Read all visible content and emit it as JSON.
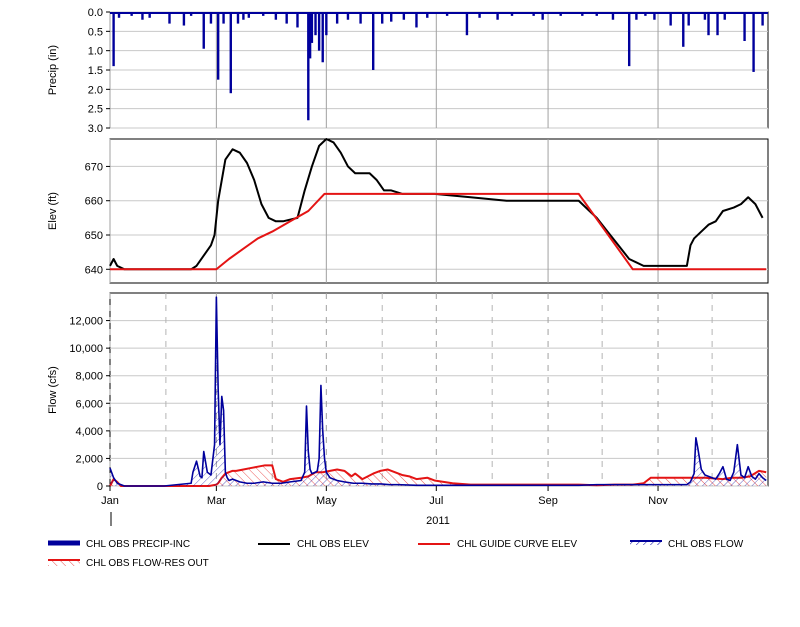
{
  "chart_data": [
    {
      "type": "bar",
      "ylabel": "Precip (in)",
      "ylim": [
        0,
        3.0
      ],
      "y_inverted": true,
      "yticks": [
        "0.0",
        "0.5",
        "1.0",
        "1.5",
        "2.0",
        "2.5",
        "3.0"
      ],
      "grid": true,
      "color": "#00009c",
      "series": [
        {
          "name": "CHL OBS PRECIP-INC",
          "days": [
            2,
            5,
            12,
            18,
            22,
            33,
            41,
            45,
            52,
            56,
            60,
            63,
            67,
            71,
            74,
            77,
            85,
            92,
            98,
            104,
            110,
            111,
            112,
            114,
            116,
            118,
            120,
            126,
            132,
            139,
            146,
            151,
            156,
            163,
            170,
            176,
            187,
            198,
            205,
            215,
            223,
            235,
            240,
            250,
            262,
            270,
            279,
            288,
            292,
            297,
            302,
            311,
            318,
            321,
            330,
            332,
            337,
            341,
            352,
            357,
            362
          ],
          "values": [
            1.4,
            0.15,
            0.1,
            0.2,
            0.15,
            0.3,
            0.35,
            0.1,
            0.95,
            0.3,
            1.75,
            0.3,
            2.1,
            0.3,
            0.2,
            0.15,
            0.1,
            0.2,
            0.3,
            0.4,
            2.8,
            1.2,
            0.8,
            0.6,
            1.0,
            1.3,
            0.6,
            0.3,
            0.2,
            0.3,
            1.5,
            0.3,
            0.25,
            0.2,
            0.4,
            0.15,
            0.1,
            0.6,
            0.15,
            0.2,
            0.1,
            0.1,
            0.2,
            0.1,
            0.1,
            0.1,
            0.2,
            1.4,
            0.2,
            0.1,
            0.2,
            0.35,
            0.9,
            0.35,
            0.2,
            0.6,
            0.6,
            0.2,
            0.75,
            1.55,
            0.35
          ]
        }
      ]
    },
    {
      "type": "line",
      "ylabel": "Elev (ft)",
      "ylim": [
        636,
        678
      ],
      "yticks": [
        "640",
        "650",
        "660",
        "670"
      ],
      "grid": true,
      "series": [
        {
          "name": "CHL OBS ELEV",
          "color": "#000000",
          "days": [
            0,
            2,
            4,
            8,
            20,
            30,
            45,
            48,
            52,
            56,
            58,
            60,
            64,
            68,
            72,
            76,
            80,
            84,
            88,
            92,
            96,
            104,
            108,
            112,
            116,
            120,
            124,
            128,
            132,
            136,
            140,
            144,
            148,
            152,
            156,
            162,
            170,
            180,
            200,
            220,
            240,
            260,
            270,
            276,
            282,
            288,
            296,
            306,
            314,
            320,
            322,
            324,
            328,
            332,
            336,
            340,
            346,
            350,
            354,
            358,
            362
          ],
          "values": [
            641,
            643,
            641,
            640,
            640,
            640,
            640,
            641,
            644,
            647,
            650,
            660,
            672,
            675,
            674,
            671,
            666,
            659,
            655,
            654,
            654,
            655,
            663,
            670,
            676,
            678,
            677,
            674,
            670,
            668,
            668,
            668,
            666,
            663,
            663,
            662,
            662,
            662,
            661,
            660,
            660,
            660,
            655,
            651,
            647,
            643,
            641,
            641,
            641,
            641,
            647,
            649,
            651,
            653,
            654,
            657,
            658,
            659,
            661,
            659,
            655
          ]
        },
        {
          "name": "CHL GUIDE CURVE ELEV",
          "color": "#e41414",
          "days": [
            0,
            59,
            66,
            74,
            82,
            90,
            100,
            110,
            119,
            130,
            150,
            200,
            250,
            260,
            290,
            296,
            364
          ],
          "values": [
            640,
            640,
            643,
            646,
            649,
            651,
            654,
            657,
            662,
            662,
            662,
            662,
            662,
            662,
            640,
            640,
            640
          ]
        }
      ]
    },
    {
      "type": "line",
      "ylabel": "Flow (cfs)",
      "ylim": [
        0,
        14000
      ],
      "yticks": [
        "0",
        "2,000",
        "4,000",
        "6,000",
        "8,000",
        "10,000",
        "12,000"
      ],
      "grid": true,
      "x_ticks": [
        "Jan",
        "Mar",
        "May",
        "Jul",
        "Sep",
        "Nov"
      ],
      "x_tick_days": [
        0,
        59,
        120,
        181,
        243,
        304
      ],
      "xlabel": "2011",
      "series": [
        {
          "name": "CHL OBS FLOW",
          "color": "#00009c",
          "days": [
            0,
            2,
            4,
            6,
            8,
            15,
            30,
            45,
            46,
            48,
            50,
            51,
            52,
            54,
            56,
            58,
            59,
            60,
            61,
            62,
            63,
            64,
            65,
            66,
            68,
            70,
            72,
            76,
            80,
            85,
            90,
            95,
            100,
            106,
            108,
            109,
            110,
            111,
            112,
            114,
            115,
            116,
            117,
            118,
            119,
            120,
            122,
            124,
            126,
            130,
            135,
            140,
            145,
            150,
            155,
            160,
            170,
            180,
            200,
            220,
            240,
            250,
            260,
            270,
            280,
            290,
            300,
            310,
            320,
            322,
            324,
            325,
            326,
            328,
            330,
            332,
            334,
            336,
            338,
            340,
            342,
            344,
            346,
            348,
            350,
            352,
            354,
            356,
            358,
            360,
            362,
            364
          ],
          "values": [
            1300,
            600,
            200,
            100,
            0,
            0,
            0,
            200,
            1000,
            1800,
            700,
            600,
            2500,
            1000,
            800,
            3000,
            13700,
            7000,
            3000,
            6500,
            5500,
            1000,
            600,
            400,
            500,
            400,
            300,
            200,
            200,
            300,
            200,
            200,
            300,
            400,
            1000,
            5800,
            2500,
            1200,
            900,
            1000,
            1100,
            2000,
            7300,
            4000,
            2000,
            1000,
            600,
            500,
            400,
            300,
            200,
            200,
            150,
            150,
            100,
            100,
            50,
            50,
            50,
            50,
            50,
            50,
            50,
            100,
            100,
            100,
            100,
            100,
            100,
            300,
            900,
            3500,
            2800,
            1200,
            800,
            700,
            600,
            500,
            900,
            1400,
            500,
            400,
            1000,
            3000,
            800,
            600,
            1400,
            700,
            500,
            900,
            600,
            400
          ]
        },
        {
          "name": "CHL OBS FLOW-RES OUT",
          "color": "#e41414",
          "days": [
            0,
            2,
            4,
            6,
            10,
            20,
            40,
            55,
            59,
            60,
            62,
            64,
            66,
            68,
            70,
            74,
            78,
            82,
            86,
            90,
            92,
            96,
            100,
            106,
            110,
            114,
            118,
            122,
            126,
            130,
            134,
            136,
            140,
            146,
            150,
            154,
            158,
            162,
            166,
            170,
            176,
            180,
            190,
            200,
            220,
            240,
            260,
            270,
            280,
            285,
            290,
            296,
            300,
            310,
            320,
            330,
            340,
            345,
            350,
            355,
            360,
            364
          ],
          "values": [
            0,
            500,
            300,
            0,
            0,
            0,
            0,
            0,
            100,
            200,
            600,
            900,
            1000,
            1100,
            1100,
            1200,
            1300,
            1400,
            1500,
            1500,
            500,
            300,
            500,
            600,
            700,
            1000,
            1000,
            1100,
            1200,
            1100,
            700,
            900,
            500,
            900,
            1100,
            1200,
            1000,
            800,
            700,
            500,
            600,
            400,
            200,
            100,
            100,
            100,
            100,
            50,
            100,
            100,
            100,
            200,
            600,
            600,
            600,
            600,
            500,
            600,
            600,
            700,
            1100,
            1000
          ]
        }
      ]
    }
  ],
  "legend": [
    {
      "label": "CHL OBS PRECIP-INC",
      "color": "#00009c",
      "style": "thick-bar"
    },
    {
      "label": "CHL OBS ELEV",
      "color": "#000000",
      "style": "line"
    },
    {
      "label": "CHL GUIDE CURVE ELEV",
      "color": "#e41414",
      "style": "line"
    },
    {
      "label": "CHL OBS FLOW",
      "color": "#00009c",
      "style": "hatched"
    },
    {
      "label": "CHL OBS FLOW-RES OUT",
      "color": "#e41414",
      "style": "hatched"
    }
  ]
}
